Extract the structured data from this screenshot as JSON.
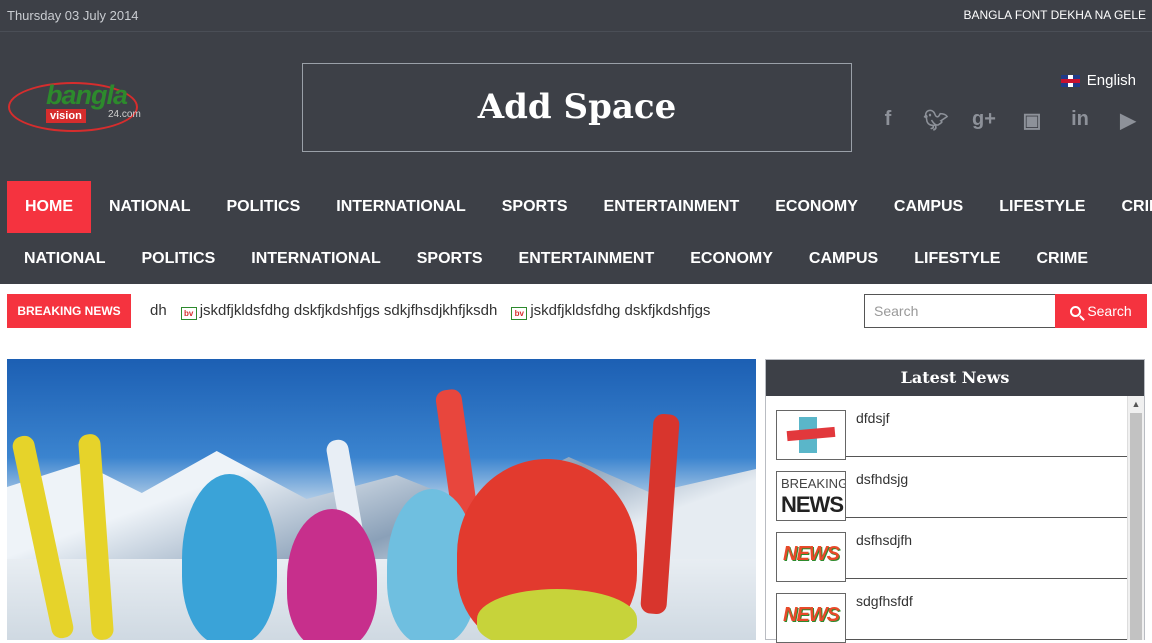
{
  "topbar": {
    "date": "Thursday 03 July 2014",
    "notice": "BANGLA FONT DEKHA NA GELE"
  },
  "logo": {
    "word": "bangla",
    "vision": "vision",
    "domain": "24.com"
  },
  "ad": {
    "text": "Add Space"
  },
  "language": {
    "label": "English",
    "flag": "uk-flag-icon"
  },
  "social": [
    "facebook-icon",
    "twitter-icon",
    "google-plus-icon",
    "instagram-icon",
    "linkedin-icon",
    "youtube-icon"
  ],
  "nav_primary": [
    "HOME",
    "NATIONAL",
    "POLITICS",
    "INTERNATIONAL",
    "SPORTS",
    "ENTERTAINMENT",
    "ECONOMY",
    "CAMPUS",
    "LIFESTYLE",
    "CRIME"
  ],
  "nav_secondary": [
    "NATIONAL",
    "POLITICS",
    "INTERNATIONAL",
    "SPORTS",
    "ENTERTAINMENT",
    "ECONOMY",
    "CAMPUS",
    "LIFESTYLE",
    "CRIME"
  ],
  "breaking": {
    "label": "BREAKING NEWS",
    "ticker": [
      "dh",
      "jskdfjkldsfdhg dskfjkdshfjgs sdkjfhsdjkhfjksdh",
      "jskdfjkldsfdhg dskfjkdshfjgs"
    ]
  },
  "search": {
    "placeholder": "Search",
    "button": "Search"
  },
  "latest": {
    "heading": "Latest News",
    "items": [
      {
        "title": "dfdsjf"
      },
      {
        "title": "dsfhdsjg"
      },
      {
        "title": "dsfhsdjfh"
      },
      {
        "title": "sdgfhsfdf"
      }
    ]
  },
  "thumbs": {
    "breaking_a": "BREAKING",
    "breaking_b": "NEWS",
    "news": "NEWS"
  },
  "colors": {
    "dark": "#3d4047",
    "accent": "#f5333f"
  }
}
